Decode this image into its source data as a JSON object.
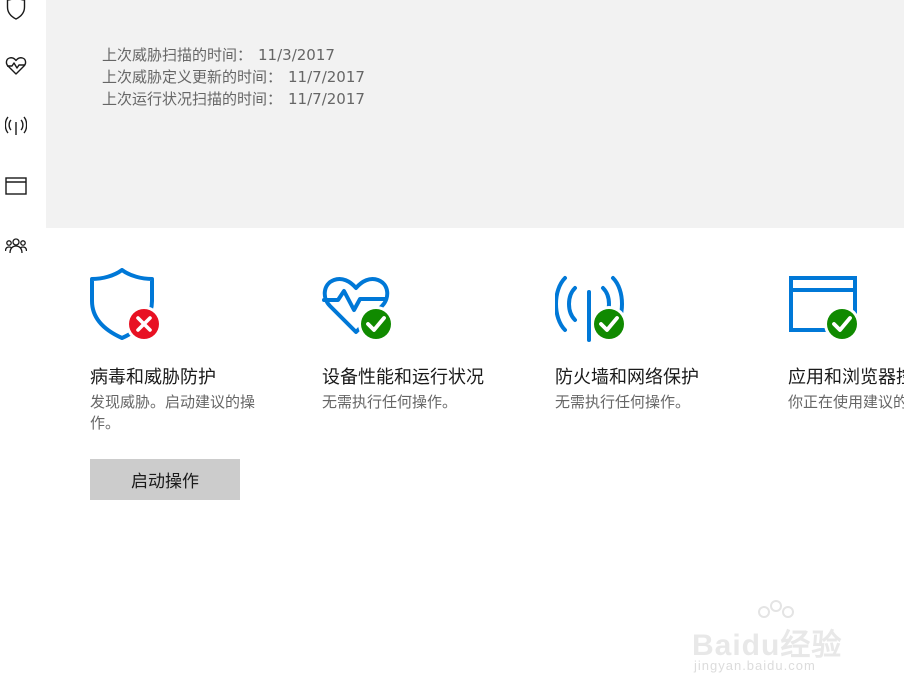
{
  "sidebar": {
    "items": [
      {
        "icon": "shield-icon"
      },
      {
        "icon": "heart-pulse-icon"
      },
      {
        "icon": "antenna-icon"
      },
      {
        "icon": "browser-window-icon"
      },
      {
        "icon": "family-icon"
      }
    ]
  },
  "scan_info": {
    "lines": [
      {
        "label": "上次威胁扫描的时间：",
        "value": "11/3/2017"
      },
      {
        "label": "上次威胁定义更新的时间：",
        "value": "11/7/2017"
      },
      {
        "label": "上次运行状况扫描的时间：",
        "value": "11/7/2017"
      }
    ]
  },
  "tiles": [
    {
      "title": "病毒和威胁防护",
      "desc": "发现威胁。启动建议的操作。",
      "status": "error"
    },
    {
      "title": "设备性能和运行状况",
      "desc": "无需执行任何操作。",
      "status": "ok"
    },
    {
      "title": "防火墙和网络保护",
      "desc": "无需执行任何操作。",
      "status": "ok"
    },
    {
      "title": "应用和浏览器控",
      "desc": "你正在使用建议的",
      "status": "ok"
    }
  ],
  "action_button": {
    "label": "启动操作"
  },
  "watermark": {
    "logo": "Baidu经验",
    "url": "jingyan.baidu.com"
  },
  "colors": {
    "accent": "#0078d7",
    "ok": "#108a00",
    "error": "#e81123",
    "header_bg": "#f2f2f2",
    "button_bg": "#cccccc"
  }
}
